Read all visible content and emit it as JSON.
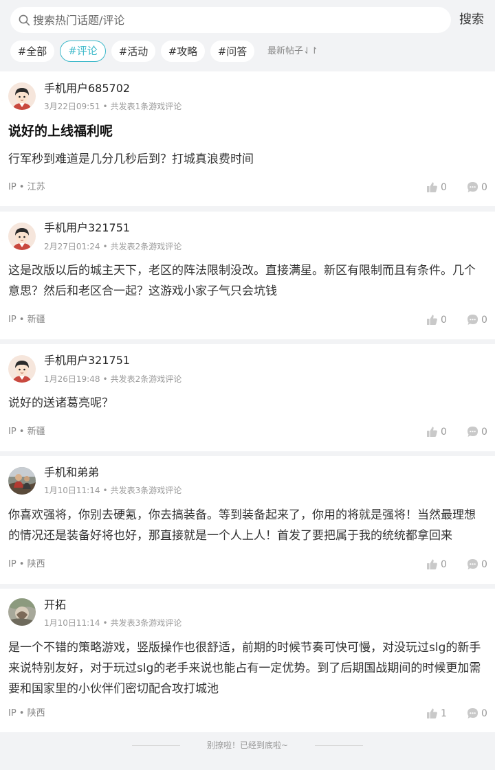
{
  "search": {
    "placeholder": "搜索热门话题/评论",
    "button_label": "搜索"
  },
  "tabs": [
    {
      "label": "#全部",
      "active": false
    },
    {
      "label": "#评论",
      "active": true
    },
    {
      "label": "#活动",
      "active": false
    },
    {
      "label": "#攻略",
      "active": false
    },
    {
      "label": "#问答",
      "active": false
    }
  ],
  "sort": {
    "label": "最新帖子⇃↾"
  },
  "posts": [
    {
      "username": "手机用户685702",
      "date": "3月22日09:51",
      "sep": "•",
      "summary": "共发表1条游戏评论",
      "title": "说好的上线福利呢",
      "body": "行军秒到难道是几分几秒后到？打城真浪费时间",
      "ip": "IP • 江苏",
      "likes": "0",
      "comments": "0",
      "avatar": "cartoon-boy-avatar"
    },
    {
      "username": "手机用户321751",
      "date": "2月27日01:24",
      "sep": "•",
      "summary": "共发表2条游戏评论",
      "body": "这是改版以后的城主天下，老区的阵法限制没改。直接满星。新区有限制而且有条件。几个意思？然后和老区合一起？这游戏小家子气只会坑钱",
      "ip": "IP • 新疆",
      "likes": "0",
      "comments": "0",
      "avatar": "cartoon-boy-avatar"
    },
    {
      "username": "手机用户321751",
      "date": "1月26日19:48",
      "sep": "•",
      "summary": "共发表2条游戏评论",
      "body": "说好的送诸葛亮呢？",
      "ip": "IP • 新疆",
      "likes": "0",
      "comments": "0",
      "avatar": "cartoon-boy-avatar"
    },
    {
      "username": "手机和弟弟",
      "date": "1月10日11:14",
      "sep": "•",
      "summary": "共发表3条游戏评论",
      "body": "你喜欢强将，你别去硬氪，你去搞装备。等到装备起来了，你用的将就是强将！当然最理想的情况还是装备好将也好，那直接就是一个人上人！首发了要把属于我的统统都拿回来",
      "ip": "IP • 陕西",
      "likes": "0",
      "comments": "0",
      "avatar": "photo-avatar"
    },
    {
      "username": "开拓",
      "date": "1月10日11:14",
      "sep": "•",
      "summary": "共发表3条游戏评论",
      "body": "是一个不错的策略游戏，竖版操作也很舒适，前期的时候节奏可快可慢，对没玩过slg的新手来说特别友好，对于玩过slg的老手来说也能占有一定优势。到了后期国战期间的时候更加需要和国家里的小伙伴们密切配合攻打城池",
      "ip": "IP • 陕西",
      "likes": "1",
      "comments": "0",
      "avatar": "photo-avatar"
    }
  ],
  "footer": {
    "text": "别撩啦！已经到底啦~"
  },
  "colors": {
    "accent": "#3bb8c9",
    "background": "#f2f3f5"
  }
}
